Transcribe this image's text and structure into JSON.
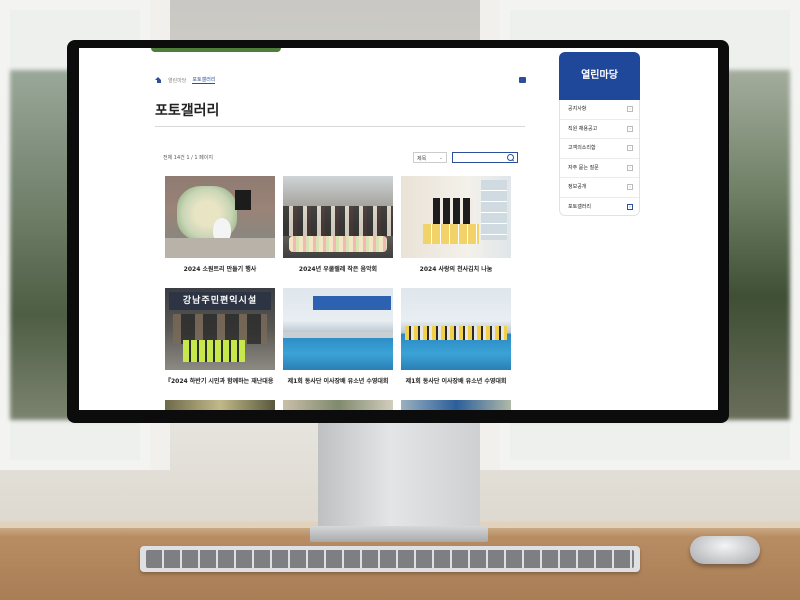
{
  "breadcrumb": {
    "home_icon": "home-icon",
    "parent": "열린마당",
    "current": "포토갤러리"
  },
  "page": {
    "title": "포토갤러리"
  },
  "list": {
    "count_text": "전체 14건 1 / 1 페이지"
  },
  "search": {
    "sort_selected": "제목",
    "placeholder": ""
  },
  "gallery": {
    "items": [
      {
        "caption": "2024 소원트리 만들기 행사"
      },
      {
        "caption": "2024년 우쿨렐레 작은 음악회"
      },
      {
        "caption": "2024 사랑의 천사김치 나눔"
      },
      {
        "caption": "『2024 하반기 시민과 함께하는 재난대응 안전..."
      },
      {
        "caption": "제1회 동사단 이사장배 유소년 수영대회"
      },
      {
        "caption": "제1회 동사단 이사장배 유소년 수영대회"
      },
      {
        "caption": ""
      },
      {
        "caption": ""
      },
      {
        "caption": ""
      }
    ],
    "thumb4_sign": "강남주민편익시설"
  },
  "side_menu": {
    "title": "열린마당",
    "items": [
      {
        "label": "공지사항"
      },
      {
        "label": "직원 채용공고"
      },
      {
        "label": "고객의소리함"
      },
      {
        "label": "자주 묻는 질문"
      },
      {
        "label": "정보공개"
      },
      {
        "label": "포토갤러리",
        "active": true
      }
    ]
  },
  "colors": {
    "accent": "#20489a",
    "link": "#2c4f9c"
  }
}
